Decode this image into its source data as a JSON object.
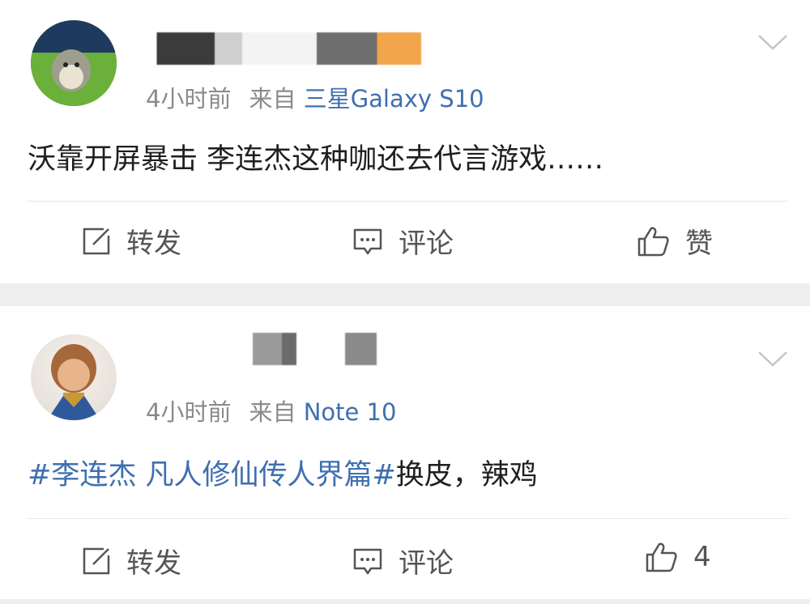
{
  "posts": [
    {
      "time": "4小时前",
      "from_label": "来自",
      "device": "三星Galaxy S10",
      "content": "沃靠开屏暴击 李连杰这种咖还去代言游戏……",
      "actions": {
        "forward": "转发",
        "comment": "评论",
        "like": "赞"
      }
    },
    {
      "time": "4小时前",
      "from_label": "来自",
      "device": "Note 10",
      "hashtag": "#李连杰 凡人修仙传人界篇#",
      "content": "换皮，辣鸡",
      "actions": {
        "forward": "转发",
        "comment": "评论",
        "like": "4"
      }
    }
  ],
  "colors": {
    "link": "#3f6fb0",
    "meta": "#8a8a8a",
    "text": "#1f1f1f",
    "action": "#555555",
    "separator": "#eeeeee"
  },
  "icons": [
    "chevron-down-icon",
    "share-edit-icon",
    "comment-icon",
    "thumbs-up-icon"
  ]
}
